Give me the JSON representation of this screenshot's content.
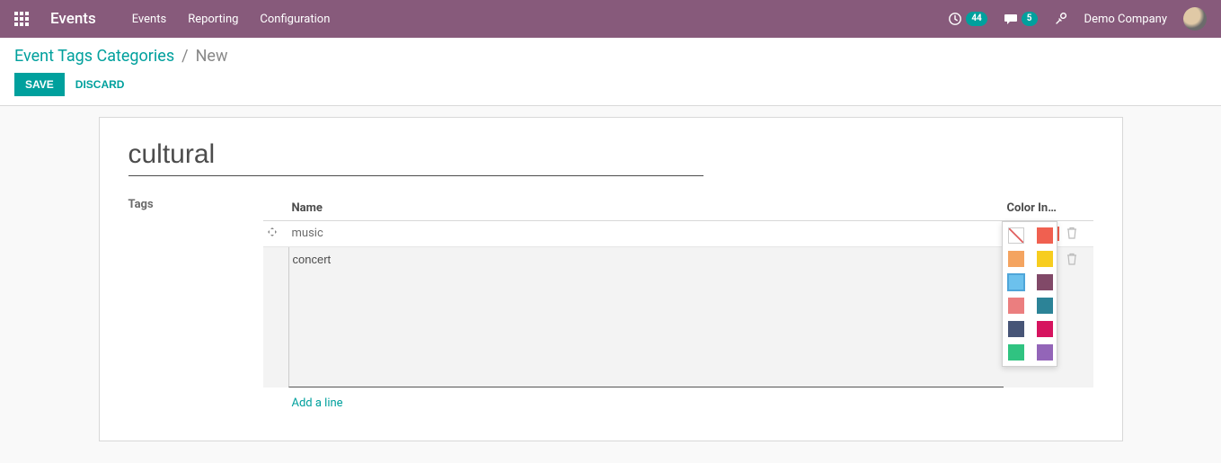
{
  "navbar": {
    "brand": "Events",
    "links": [
      "Events",
      "Reporting",
      "Configuration"
    ],
    "activities_badge": "44",
    "messages_badge": "5",
    "company": "Demo Company"
  },
  "breadcrumb": {
    "parent": "Event Tags Categories",
    "current": "New"
  },
  "buttons": {
    "save": "Save",
    "discard": "Discard"
  },
  "form": {
    "title": "cultural",
    "tags_label": "Tags",
    "columns": {
      "name": "Name",
      "color": "Color In…"
    },
    "rows": [
      {
        "name": "music",
        "color": "#f06050"
      }
    ],
    "editing_row": {
      "name": "concert"
    },
    "add_line": "Add a line"
  },
  "color_palette": [
    [
      "none",
      "#f06050"
    ],
    [
      "#f4a460",
      "#f7cd1f"
    ],
    [
      "#6cc1ed",
      "#814968"
    ],
    [
      "#eb7e7f",
      "#2c8397"
    ],
    [
      "#475577",
      "#d6145f"
    ],
    [
      "#30c381",
      "#9365b8"
    ]
  ],
  "selected_color_index": [
    2,
    0
  ]
}
